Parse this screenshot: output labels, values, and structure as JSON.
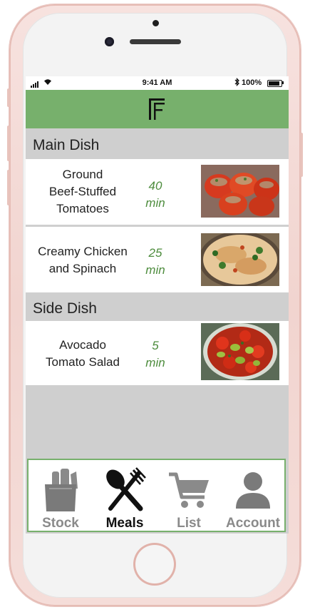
{
  "status_bar": {
    "time": "9:41 AM",
    "battery": "100%",
    "bluetooth_icon": "bluetooth-icon"
  },
  "app": {
    "logo_icon": "f-logo-icon",
    "header_color": "#77b06c"
  },
  "sections": [
    {
      "title": "Main Dish",
      "meals": [
        {
          "name_lines": [
            "Ground",
            "Beef-Stuffed",
            "Tomatoes"
          ],
          "time_value": "40",
          "time_unit": "min",
          "image": "stuffed-tomatoes-photo"
        },
        {
          "name_lines": [
            "Creamy Chicken",
            "and Spinach"
          ],
          "time_value": "25",
          "time_unit": "min",
          "image": "creamy-chicken-photo"
        }
      ]
    },
    {
      "title": "Side Dish",
      "meals": [
        {
          "name_lines": [
            "Avocado",
            "Tomato Salad"
          ],
          "time_value": "5",
          "time_unit": "min",
          "image": "avocado-salad-photo"
        }
      ]
    }
  ],
  "tabs": [
    {
      "label": "Stock",
      "icon": "grocery-bag-icon",
      "active": false
    },
    {
      "label": "Meals",
      "icon": "fork-spoon-icon",
      "active": true
    },
    {
      "label": "List",
      "icon": "cart-icon",
      "active": false
    },
    {
      "label": "Account",
      "icon": "user-icon",
      "active": false
    }
  ],
  "colors": {
    "accent_green": "#77b06c",
    "time_green": "#4d8c3d",
    "section_gray": "#cfcfcf"
  }
}
